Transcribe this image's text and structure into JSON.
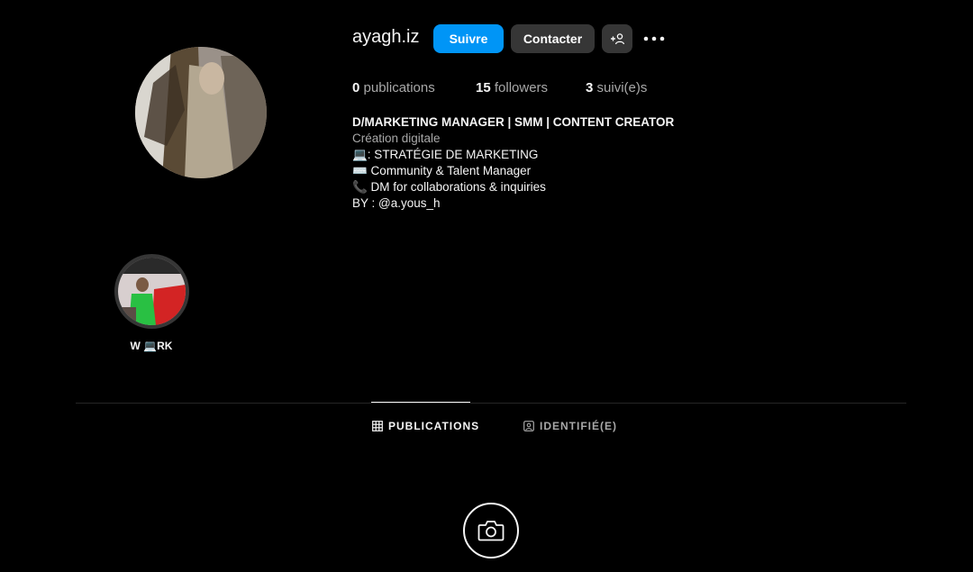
{
  "profile": {
    "username": "ayagh.iz",
    "follow_label": "Suivre",
    "contact_label": "Contacter",
    "add_user_label": "+👤"
  },
  "stats": {
    "posts_count": "0",
    "posts_label": "publications",
    "followers_count": "15",
    "followers_label": "followers",
    "following_count": "3",
    "following_label": "suivi(e)s"
  },
  "bio": {
    "name": "D/MARKETING MANAGER | SMM | CONTENT CREATOR",
    "category": "Création digitale",
    "lines": [
      "💻: STRATÉGIE DE MARKETING",
      "⌨️ Community & Talent Manager",
      "📞 DM for collaborations & inquiries",
      "BY : @a.yous_h"
    ]
  },
  "highlights": [
    {
      "label": "W 💻RK"
    }
  ],
  "tabs": [
    {
      "label": "PUBLICATIONS",
      "icon": "grid-icon",
      "active": true
    },
    {
      "label": "IDENTIFIÉ(E)",
      "icon": "tagged-icon",
      "active": false
    }
  ],
  "colors": {
    "background": "#000000",
    "accent": "#0095f6",
    "secondary_button": "#363636",
    "muted_text": "#a8a8a8"
  }
}
